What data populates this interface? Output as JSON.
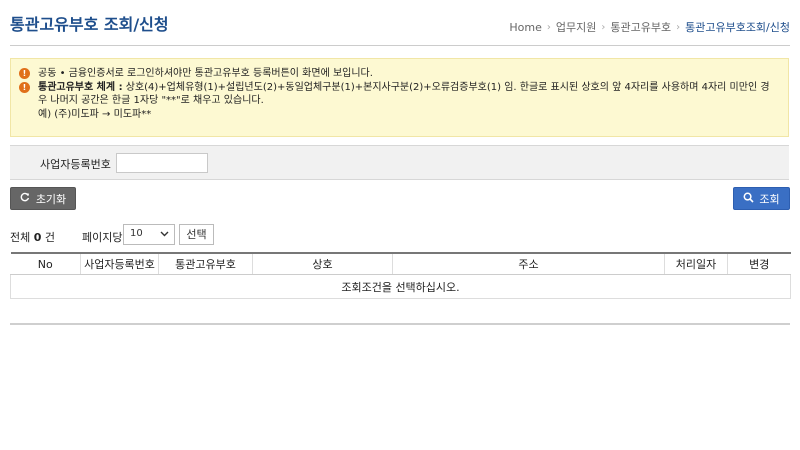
{
  "header": {
    "title": "통관고유부호 조회/신청",
    "breadcrumb": [
      "Home",
      "업무지원",
      "통관고유부호",
      "통관고유부호조회/신청"
    ]
  },
  "notice": {
    "line1": "공동 • 금융인증서로 로그인하셔야만 통관고유부호 등록버튼이 화면에 보입니다.",
    "line2_label": "통관고유부호 체계 :",
    "line2_text": " 상호(4)+업체유형(1)+설립년도(2)+동일업체구분(1)+본지사구분(2)+오류검증부호(1) 임. 한글로 표시된 상호의 앞 4자리를 사용하며 4자리 미만인 경우 나머지 공간은 한글 1자당 \"**\"로 채우고 있습니다.",
    "example": "예) (주)미도파 → 미도파**"
  },
  "search": {
    "label": "사업자등록번호",
    "value": ""
  },
  "buttons": {
    "reset": "초기화",
    "search": "조회",
    "select": "선택"
  },
  "list": {
    "total_prefix": "전체",
    "total_count": "0",
    "total_suffix": "건",
    "per_page_label": "페이지당",
    "per_page_value": "10",
    "columns": [
      "No",
      "사업자등록번호",
      "통관고유부호",
      "상호",
      "주소",
      "처리일자",
      "변경"
    ],
    "empty_message": "조회조건을 선택하십시오."
  },
  "colors": {
    "title": "#1e4e8c",
    "notice_bg": "#fdf9d2",
    "warn_icon": "#e0701a",
    "search_button": "#3a6fc4",
    "reset_button": "#666666"
  }
}
